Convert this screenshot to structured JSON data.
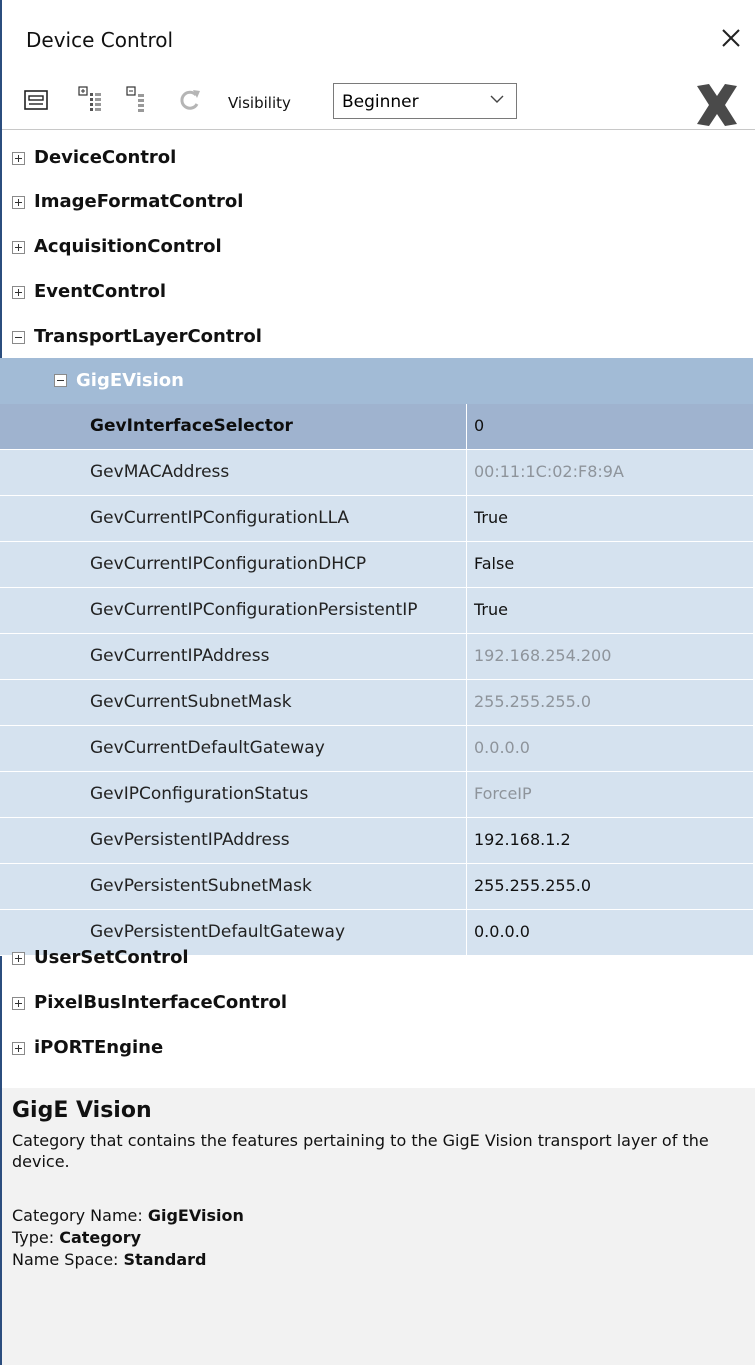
{
  "window": {
    "title": "Device Control"
  },
  "toolbar": {
    "icons": [
      "grid-view-icon",
      "expand-all-icon",
      "collapse-all-icon",
      "refresh-icon"
    ],
    "visibility_label": "Visibility",
    "visibility_value": "Beginner",
    "disconnect_icon": "big-x-icon"
  },
  "tree": {
    "categories_top": [
      {
        "label": "DeviceControl",
        "expanded": false
      },
      {
        "label": "ImageFormatControl",
        "expanded": false
      },
      {
        "label": "AcquisitionControl",
        "expanded": false
      },
      {
        "label": "EventControl",
        "expanded": false
      },
      {
        "label": "TransportLayerControl",
        "expanded": true
      }
    ],
    "subcategory": {
      "label": "GigEVision",
      "expanded": true
    },
    "properties": [
      {
        "name": "GevInterfaceSelector",
        "value": "0",
        "readonly": false,
        "selected": true
      },
      {
        "name": "GevMACAddress",
        "value": "00:11:1C:02:F8:9A",
        "readonly": true
      },
      {
        "name": "GevCurrentIPConfigurationLLA",
        "value": "True",
        "readonly": false
      },
      {
        "name": "GevCurrentIPConfigurationDHCP",
        "value": "False",
        "readonly": false
      },
      {
        "name": "GevCurrentIPConfigurationPersistentIP",
        "value": "True",
        "readonly": false
      },
      {
        "name": "GevCurrentIPAddress",
        "value": "192.168.254.200",
        "readonly": true
      },
      {
        "name": "GevCurrentSubnetMask",
        "value": "255.255.255.0",
        "readonly": true
      },
      {
        "name": "GevCurrentDefaultGateway",
        "value": "0.0.0.0",
        "readonly": true
      },
      {
        "name": "GevIPConfigurationStatus",
        "value": "ForceIP",
        "readonly": true
      },
      {
        "name": "GevPersistentIPAddress",
        "value": "192.168.1.2",
        "readonly": false
      },
      {
        "name": "GevPersistentSubnetMask",
        "value": "255.255.255.0",
        "readonly": false
      },
      {
        "name": "GevPersistentDefaultGateway",
        "value": "0.0.0.0",
        "readonly": false
      }
    ],
    "categories_bottom": [
      {
        "label": "UserSetControl",
        "expanded": false
      },
      {
        "label": "PixelBusInterfaceControl",
        "expanded": false
      },
      {
        "label": "iPORTEngine",
        "expanded": false
      }
    ]
  },
  "description": {
    "title": "GigE Vision",
    "text": "Category that contains the features pertaining to the GigE Vision transport layer of the device.",
    "category_name_label": "Category Name: ",
    "category_name_value": "GigEVision",
    "type_label": "Type: ",
    "type_value": "Category",
    "namespace_label": "Name Space: ",
    "namespace_value": "Standard"
  },
  "colors": {
    "selected_row": "#9fb3cf",
    "row": "#d5e2ef",
    "subheader": "#a2bbd6",
    "readonly_text": "#8e949b"
  }
}
